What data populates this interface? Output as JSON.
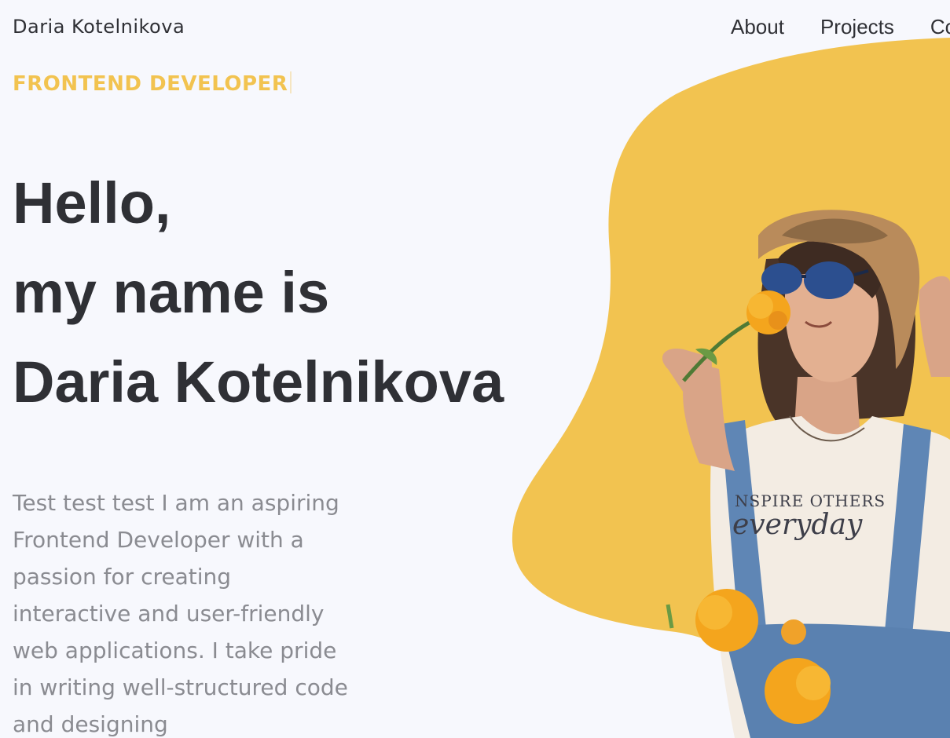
{
  "header": {
    "brand": "Daria Kotelnikova",
    "nav": [
      {
        "label": "About"
      },
      {
        "label": "Projects"
      },
      {
        "label": "Contact"
      }
    ]
  },
  "hero": {
    "role": "FRONTEND DEVELOPER",
    "title_lines": [
      "Hello,",
      "my name is",
      "Daria Kotelnikova"
    ],
    "bio": "Test test test I am an aspiring Frontend Developer with a passion for creating interactive and user-friendly web applications. I take pride in writing well-structured code and designing"
  },
  "tshirt": {
    "line1": "NSPIRE OTHERS",
    "line2": "everyday"
  },
  "colors": {
    "accent": "#f2c350",
    "text": "#2f3035",
    "muted": "#8a8b91",
    "background": "#f7f8fd"
  },
  "icons": {
    "cursor": "text-cursor-icon"
  }
}
